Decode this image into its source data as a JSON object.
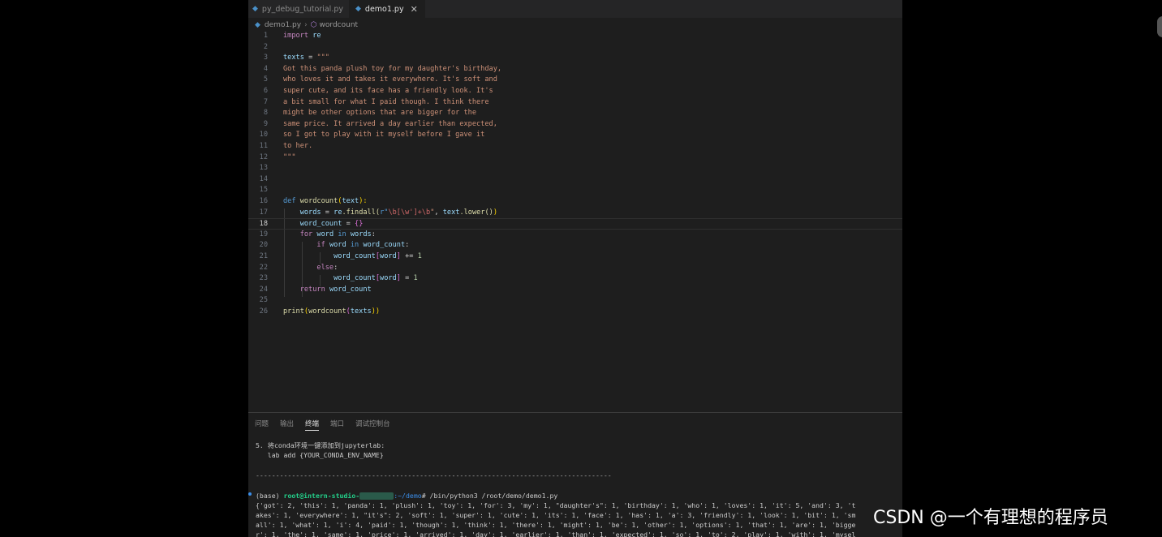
{
  "tabs": [
    {
      "label": "py_debug_tutorial.py",
      "active": false
    },
    {
      "label": "demo1.py",
      "active": true,
      "close": "✕"
    }
  ],
  "breadcrumb": {
    "file": "demo1.py",
    "separator": "›",
    "symbol": "wordcount"
  },
  "code_lines": [
    {
      "n": "1"
    },
    {
      "n": "2"
    },
    {
      "n": "3"
    },
    {
      "n": "4"
    },
    {
      "n": "5"
    },
    {
      "n": "6"
    },
    {
      "n": "7"
    },
    {
      "n": "8"
    },
    {
      "n": "9"
    },
    {
      "n": "10"
    },
    {
      "n": "11"
    },
    {
      "n": "12"
    },
    {
      "n": "13"
    },
    {
      "n": "14"
    },
    {
      "n": "15"
    },
    {
      "n": "16"
    },
    {
      "n": "17"
    },
    {
      "n": "18"
    },
    {
      "n": "19"
    },
    {
      "n": "20"
    },
    {
      "n": "21"
    },
    {
      "n": "22"
    },
    {
      "n": "23"
    },
    {
      "n": "24"
    },
    {
      "n": "25"
    },
    {
      "n": "26"
    }
  ],
  "code": {
    "l1": [
      "import",
      "re"
    ],
    "l3": [
      "texts",
      "=",
      "\"\"\""
    ],
    "l4": "Got this panda plush toy for my daughter's birthday,",
    "l5": "who loves it and takes it everywhere. It's soft and",
    "l6": "super cute, and its face has a friendly look. It's",
    "l7": "a bit small for what I paid though. I think there",
    "l8": "might be other options that are bigger for the",
    "l9": "same price. It arrived a day earlier than expected,",
    "l10": "so I got to play with it myself before I gave it",
    "l11": "to her.",
    "l12": "\"\"\"",
    "l16": [
      "def",
      "wordcount",
      "(",
      "text",
      "):"
    ],
    "l17": [
      "words",
      "=",
      "re",
      ".findall(",
      "r\"",
      "\\b[\\w']+\\b",
      "\"",
      ",",
      "text",
      ".lower()",
      ")"
    ],
    "l18": [
      "word_count",
      "=",
      "{}"
    ],
    "l19": [
      "for",
      "word",
      "in",
      "words",
      ":"
    ],
    "l20": [
      "if",
      "word",
      "in",
      "word_count",
      ":"
    ],
    "l21": [
      "word_count",
      "[",
      "word",
      "]",
      "+=",
      "1"
    ],
    "l22": [
      "else",
      ":"
    ],
    "l23": [
      "word_count",
      "[",
      "word",
      "]",
      "=",
      "1"
    ],
    "l24": [
      "return",
      "word_count"
    ],
    "l26": [
      "print",
      "(",
      "wordcount",
      "(",
      "texts",
      "))"
    ]
  },
  "panel": {
    "tabs": [
      {
        "label": "问题",
        "active": false
      },
      {
        "label": "输出",
        "active": false
      },
      {
        "label": "终端",
        "active": true
      },
      {
        "label": "端口",
        "active": false
      },
      {
        "label": "调试控制台",
        "active": false
      }
    ]
  },
  "terminal": {
    "l1": "5. 将conda环境一键添加到jupyterlab:",
    "l2": "   lab add {YOUR_CONDA_ENV_NAME}",
    "divider": "-----------------------------------------------------------------------------------------",
    "prompt_base": "(base) ",
    "prompt_user": "root@intern-studio-",
    "prompt_path": ":~/demo",
    "prompt_cmd": "# /bin/python3 /root/demo/demo1.py",
    "out1": "{'got': 2, 'this': 1, 'panda': 1, 'plush': 1, 'toy': 1, 'for': 3, 'my': 1, \"daughter's\": 1, 'birthday': 1, 'who': 1, 'loves': 1, 'it': 5, 'and': 3, 't",
    "out2": "akes': 1, 'everywhere': 1, \"it's\": 2, 'soft': 1, 'super': 1, 'cute': 1, 'its': 1, 'face': 1, 'has': 1, 'a': 3, 'friendly': 1, 'look': 1, 'bit': 1, 'sm",
    "out3": "all': 1, 'what': 1, 'i': 4, 'paid': 1, 'though': 1, 'think': 1, 'there': 1, 'might': 1, 'be': 1, 'other': 1, 'options': 1, 'that': 1, 'are': 1, 'bigge",
    "out4": "r': 1, 'the': 1, 'same': 1, 'price': 1, 'arrived': 1, 'day': 1, 'earlier': 1, 'than': 1, 'expected': 1, 'so': 1, 'to': 2, 'play': 1, 'with': 1, 'mysel"
  },
  "watermark": "CSDN @一个有理想的程序员",
  "icons": {
    "python_file": "python-file-icon",
    "symbol": "cube-icon"
  }
}
